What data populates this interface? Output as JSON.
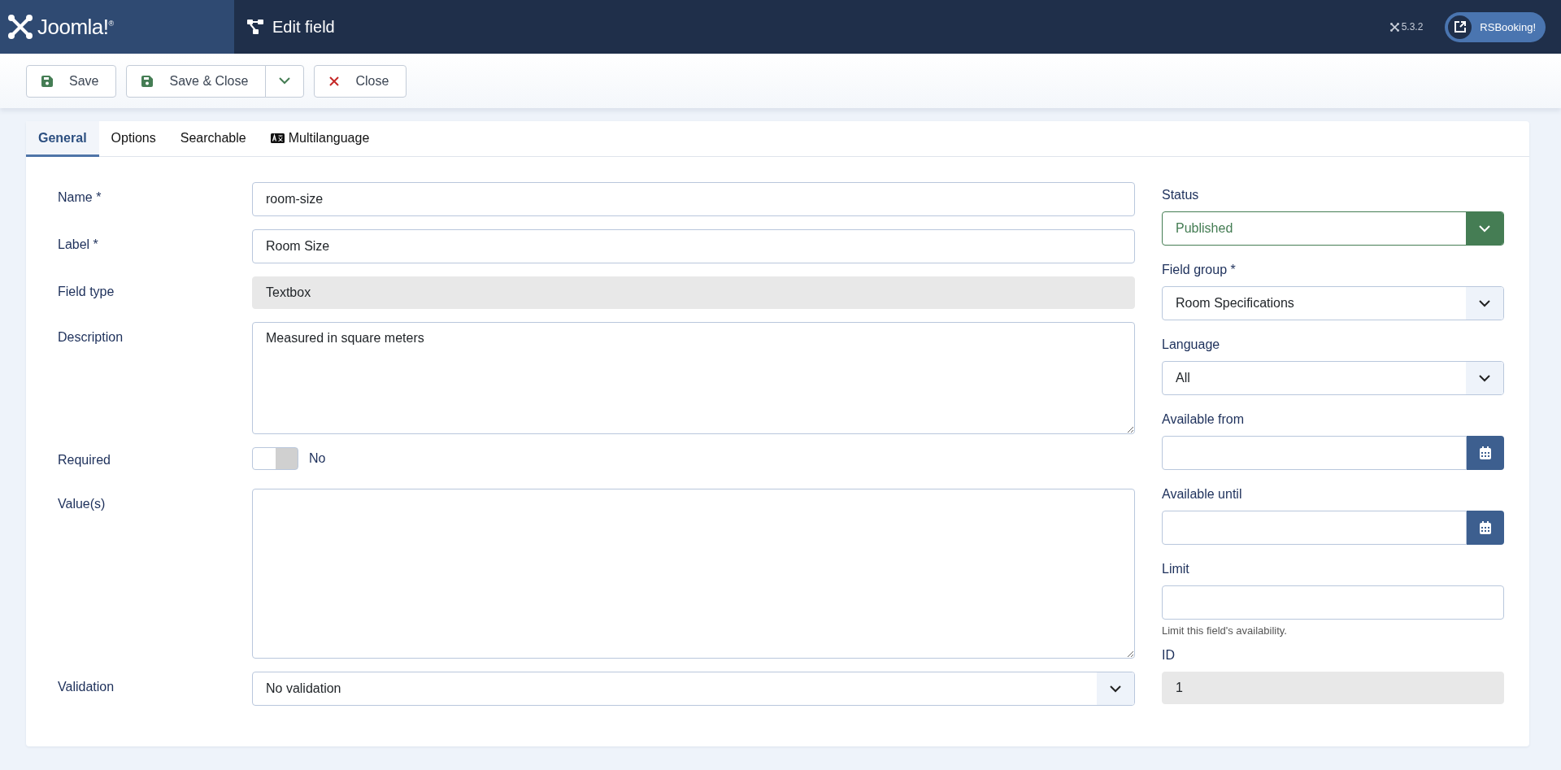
{
  "header": {
    "logo": "Joomla!$^{®}$",
    "title": "Edit field",
    "version": "5.3.2",
    "site_button": "RSBooking!"
  },
  "toolbar": [
    {
      "kind": "save",
      "label": "Save"
    },
    {
      "kind": "save-split",
      "label": "Save & Close"
    },
    {
      "kind": "close",
      "label": "Close"
    }
  ],
  "tabs": [
    {
      "kind": "plain",
      "label": "General",
      "selected": true
    },
    {
      "kind": "plain",
      "label": "Options",
      "selected": false
    },
    {
      "kind": "plain",
      "label": "Searchable",
      "selected": false
    },
    {
      "kind": "language",
      "label": "Multilanguage",
      "selected": false
    }
  ],
  "main_fields": [
    {
      "kind": "text",
      "label": "Name *",
      "value": "room-size"
    },
    {
      "kind": "text",
      "label": "Label *",
      "value": "Room Size"
    },
    {
      "kind": "readonly",
      "label": "Field type",
      "value": "Textbox"
    },
    {
      "kind": "textarea",
      "label": "Description",
      "value": "Measured in square meters"
    },
    {
      "kind": "toggle",
      "label": "Required",
      "on": false,
      "value": "No"
    },
    {
      "kind": "tallarea",
      "label": "Value(s)"
    },
    {
      "kind": "select",
      "label": "Validation",
      "value": "No validation"
    }
  ],
  "side_fields": [
    {
      "kind": "status",
      "label": "Status",
      "value": "Published"
    },
    {
      "kind": "select",
      "label": "Field group *",
      "value": "Room Specifications"
    },
    {
      "kind": "select",
      "label": "Language",
      "value": "All"
    },
    {
      "kind": "date",
      "label": "Available from"
    },
    {
      "kind": "date",
      "label": "Available until"
    },
    {
      "kind": "text",
      "label": "Limit",
      "help": "Limit this field's availability."
    },
    {
      "kind": "readonly",
      "label": "ID",
      "value": "1"
    }
  ]
}
